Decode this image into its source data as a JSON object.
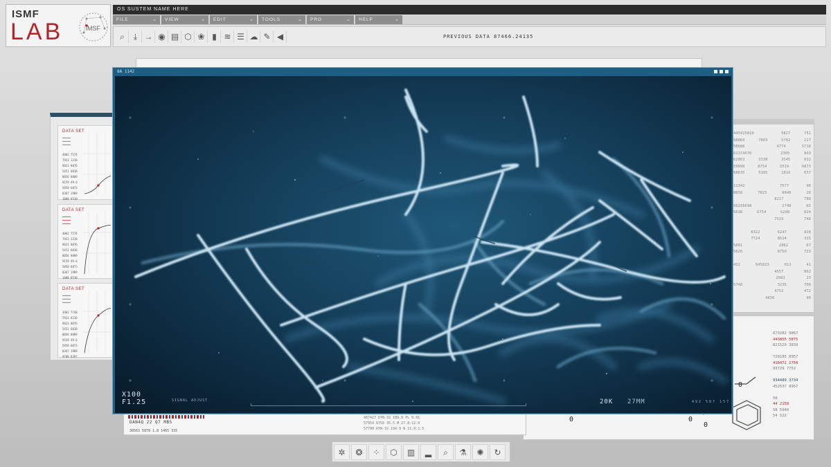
{
  "logo": {
    "brand_top": "ISMF",
    "brand_main": "LAB",
    "seal_text": "iMSF"
  },
  "window": {
    "title": "OS SUSTEM NAME HERE"
  },
  "menu": [
    {
      "label": "FILE"
    },
    {
      "label": "VIEW"
    },
    {
      "label": "EDIT"
    },
    {
      "label": "TOOLS"
    },
    {
      "label": "PRO"
    },
    {
      "label": "HELP"
    }
  ],
  "toolbar": {
    "tools": [
      {
        "name": "search-icon",
        "glyph": "⌕"
      },
      {
        "name": "download-icon",
        "glyph": "⤓"
      },
      {
        "name": "arrow-right-icon",
        "glyph": "→"
      },
      {
        "name": "eye-icon",
        "glyph": "◉"
      },
      {
        "name": "clipboard-icon",
        "glyph": "▤"
      },
      {
        "name": "molecule-icon",
        "glyph": "⬡"
      },
      {
        "name": "cells-icon",
        "glyph": "❀"
      },
      {
        "name": "signal-icon",
        "glyph": "▮"
      },
      {
        "name": "wifi-icon",
        "glyph": "≋"
      },
      {
        "name": "sliders-icon",
        "glyph": "☰"
      },
      {
        "name": "cloud-icon",
        "glyph": "☁"
      },
      {
        "name": "pen-icon",
        "glyph": "✎"
      },
      {
        "name": "speaker-icon",
        "glyph": "◀"
      }
    ],
    "previous_data": "PREVIOUS DATA 87466.24135"
  },
  "left_panel": {
    "cards": [
      {
        "title": "DATA SET",
        "rows": [
          "4862 7574",
          "7923 1218",
          "9823 8076",
          "5451 6018",
          "8056 8889",
          "9159 49.6",
          "5850 6873",
          "0367 1989",
          "1088 8510"
        ]
      },
      {
        "title": "DATA SET",
        "rows": [
          "4862 7574",
          "7923 1218",
          "9823 8076",
          "5451 6018",
          "8056 8889",
          "9159 49.6",
          "5850 6873",
          "0367 1989",
          "1088 8510"
        ]
      },
      {
        "title": "DATA SET",
        "rows": [
          "3982 7748",
          "7923 8216",
          "9823 8076",
          "5451 6018",
          "8056 8889",
          "9159 49.6",
          "5858 6873",
          "0367 1989",
          "9788 8397"
        ]
      }
    ]
  },
  "right_panel": {
    "rows": [
      [
        "445425810",
        "",
        "5827",
        "751"
      ],
      [
        "58860",
        "7803",
        "5782",
        "227"
      ],
      [
        "58686",
        "",
        "4774",
        "5718"
      ],
      [
        "62374676",
        "",
        "2395",
        "803"
      ],
      [
        "62863",
        "3338",
        "3545",
        "832"
      ],
      [
        "59896",
        "8754",
        "5519",
        "6873"
      ],
      [
        "68635",
        "5185",
        "1810",
        "657"
      ],
      [
        "",
        "",
        "",
        ""
      ],
      [
        "11342",
        "",
        "7577",
        "96"
      ],
      [
        "8858",
        "7823",
        "6846",
        "26"
      ],
      [
        "",
        "",
        "8117",
        "780"
      ],
      [
        "56256698",
        "",
        "2748",
        "65"
      ],
      [
        "5638",
        "6754",
        "6290",
        "824"
      ],
      [
        "",
        "",
        "7519",
        "746"
      ],
      [
        "",
        "",
        "",
        ""
      ],
      [
        "",
        "8322",
        "6247",
        "828"
      ],
      [
        "",
        "7724",
        "8614",
        "315"
      ],
      [
        "5881",
        "",
        "2962",
        "67"
      ],
      [
        "5826",
        "",
        "8750",
        "723"
      ],
      [
        "",
        "",
        "",
        ""
      ],
      [
        "432",
        "645823",
        "613",
        "41"
      ],
      [
        "",
        "",
        "4557",
        "862"
      ],
      [
        "",
        "",
        "2683",
        "23"
      ],
      [
        "5748",
        "",
        "3235",
        "700"
      ],
      [
        "",
        "",
        "4753",
        "472"
      ],
      [
        "",
        "",
        "4830",
        "",
        "90"
      ]
    ]
  },
  "lower_right_panel": {
    "list": [
      "673282 9867",
      "443855 5875",
      "821529 3839",
      "",
      "728185 8957",
      "418472 2758",
      "93729 7752",
      "",
      "934489 3734",
      "452537 8957",
      "",
      "58",
      "44 2158",
      "58 5940",
      "54 522"
    ]
  },
  "bottom_strip": {
    "codes": "DAN4Q 22    Q7    MB5",
    "row2": "38563   5878   1.8   1465   335",
    "mid": [
      "487427   DYN-32   189.8   PL   0.01",
      "57959    8755     35.5   M    27.8:12.0",
      "5779H    DYN-32   194.9   N    21.0:1.5"
    ]
  },
  "viewer": {
    "tag": "8A 1142",
    "magnification": "X100",
    "f_stop": "F1.25",
    "signal": "SIGNAL ADJUST",
    "resolution": "20K",
    "focal": "27MM",
    "small_readout": "492  587  157"
  },
  "dock": {
    "items": [
      {
        "name": "virus-icon",
        "glyph": "✲"
      },
      {
        "name": "cells-icon",
        "glyph": "❂"
      },
      {
        "name": "molecule-network-icon",
        "glyph": "⁘"
      },
      {
        "name": "hexagon-icon",
        "glyph": "⬡"
      },
      {
        "name": "barcode-icon",
        "glyph": "▥"
      },
      {
        "name": "signal-bars-icon",
        "glyph": "▂"
      },
      {
        "name": "magnifier-icon",
        "glyph": "⌕"
      },
      {
        "name": "vial-icon",
        "glyph": "⚗"
      },
      {
        "name": "atom-icon",
        "glyph": "✺"
      },
      {
        "name": "refresh-icon",
        "glyph": "↻"
      }
    ]
  },
  "colors": {
    "accent_red": "#b0252a",
    "viewer_blue": "#1c5f86",
    "navy": "#2d4f66"
  }
}
